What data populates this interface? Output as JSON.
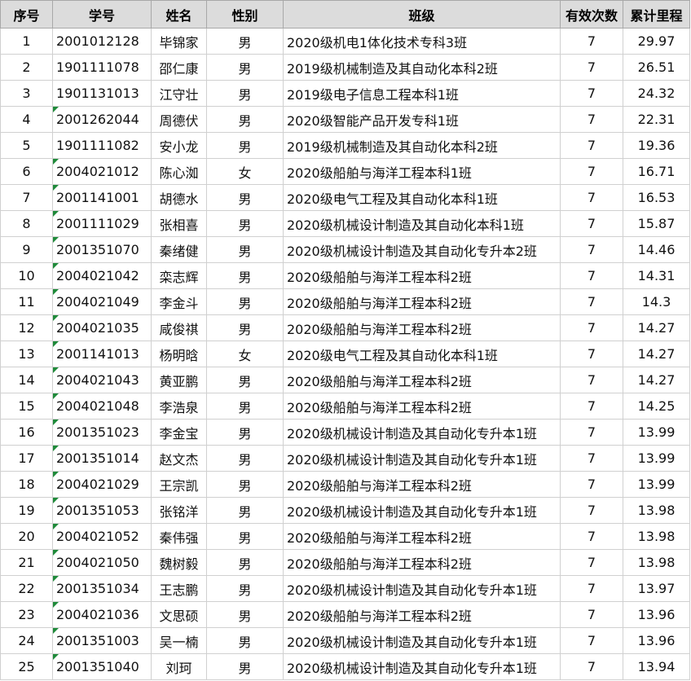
{
  "headers": [
    "序号",
    "学号",
    "姓名",
    "性别",
    "班级",
    "有效次数",
    "累计里程"
  ],
  "rows": [
    {
      "seq": "1",
      "id": "2001012128",
      "name": "毕锦家",
      "gender": "男",
      "class": "2020级机电1体化技术专科3班",
      "count": "7",
      "mileage": "29.97",
      "flag": false
    },
    {
      "seq": "2",
      "id": "1901111078",
      "name": "邵仁康",
      "gender": "男",
      "class": "2019级机械制造及其自动化本科2班",
      "count": "7",
      "mileage": "26.51",
      "flag": false
    },
    {
      "seq": "3",
      "id": "1901131013",
      "name": "江守壮",
      "gender": "男",
      "class": "2019级电子信息工程本科1班",
      "count": "7",
      "mileage": "24.32",
      "flag": false
    },
    {
      "seq": "4",
      "id": "2001262044",
      "name": "周德伏",
      "gender": "男",
      "class": "2020级智能产品开发专科1班",
      "count": "7",
      "mileage": "22.31",
      "flag": true
    },
    {
      "seq": "5",
      "id": "1901111082",
      "name": "安小龙",
      "gender": "男",
      "class": "2019级机械制造及其自动化本科2班",
      "count": "7",
      "mileage": "19.36",
      "flag": false
    },
    {
      "seq": "6",
      "id": "2004021012",
      "name": "陈心洳",
      "gender": "女",
      "class": "2020级船舶与海洋工程本科1班",
      "count": "7",
      "mileage": "16.71",
      "flag": true
    },
    {
      "seq": "7",
      "id": "2001141001",
      "name": "胡德水",
      "gender": "男",
      "class": "2020级电气工程及其自动化本科1班",
      "count": "7",
      "mileage": "16.53",
      "flag": true
    },
    {
      "seq": "8",
      "id": "2001111029",
      "name": "张相喜",
      "gender": "男",
      "class": "2020级机械设计制造及其自动化本科1班",
      "count": "7",
      "mileage": "15.87",
      "flag": true
    },
    {
      "seq": "9",
      "id": "2001351070",
      "name": "秦绪健",
      "gender": "男",
      "class": "2020级机械设计制造及其自动化专升本2班",
      "count": "7",
      "mileage": "14.46",
      "flag": true
    },
    {
      "seq": "10",
      "id": "2004021042",
      "name": "栾志辉",
      "gender": "男",
      "class": "2020级船舶与海洋工程本科2班",
      "count": "7",
      "mileage": "14.31",
      "flag": true
    },
    {
      "seq": "11",
      "id": "2004021049",
      "name": "李金斗",
      "gender": "男",
      "class": "2020级船舶与海洋工程本科2班",
      "count": "7",
      "mileage": "14.3",
      "flag": true
    },
    {
      "seq": "12",
      "id": "2004021035",
      "name": "咸俊祺",
      "gender": "男",
      "class": "2020级船舶与海洋工程本科2班",
      "count": "7",
      "mileage": "14.27",
      "flag": true
    },
    {
      "seq": "13",
      "id": "2001141013",
      "name": "杨明晗",
      "gender": "女",
      "class": "2020级电气工程及其自动化本科1班",
      "count": "7",
      "mileage": "14.27",
      "flag": true
    },
    {
      "seq": "14",
      "id": "2004021043",
      "name": "黄亚鹏",
      "gender": "男",
      "class": "2020级船舶与海洋工程本科2班",
      "count": "7",
      "mileage": "14.27",
      "flag": true
    },
    {
      "seq": "15",
      "id": "2004021048",
      "name": "李浩泉",
      "gender": "男",
      "class": "2020级船舶与海洋工程本科2班",
      "count": "7",
      "mileage": "14.25",
      "flag": true
    },
    {
      "seq": "16",
      "id": "2001351023",
      "name": "李金宝",
      "gender": "男",
      "class": "2020级机械设计制造及其自动化专升本1班",
      "count": "7",
      "mileage": "13.99",
      "flag": true
    },
    {
      "seq": "17",
      "id": "2001351014",
      "name": "赵文杰",
      "gender": "男",
      "class": "2020级机械设计制造及其自动化专升本1班",
      "count": "7",
      "mileage": "13.99",
      "flag": true
    },
    {
      "seq": "18",
      "id": "2004021029",
      "name": "王宗凯",
      "gender": "男",
      "class": "2020级船舶与海洋工程本科2班",
      "count": "7",
      "mileage": "13.99",
      "flag": true
    },
    {
      "seq": "19",
      "id": "2001351053",
      "name": "张铭洋",
      "gender": "男",
      "class": "2020级机械设计制造及其自动化专升本1班",
      "count": "7",
      "mileage": "13.98",
      "flag": true
    },
    {
      "seq": "20",
      "id": "2004021052",
      "name": "秦伟强",
      "gender": "男",
      "class": "2020级船舶与海洋工程本科2班",
      "count": "7",
      "mileage": "13.98",
      "flag": true
    },
    {
      "seq": "21",
      "id": "2004021050",
      "name": "魏树毅",
      "gender": "男",
      "class": "2020级船舶与海洋工程本科2班",
      "count": "7",
      "mileage": "13.98",
      "flag": true
    },
    {
      "seq": "22",
      "id": "2001351034",
      "name": "王志鹏",
      "gender": "男",
      "class": "2020级机械设计制造及其自动化专升本1班",
      "count": "7",
      "mileage": "13.97",
      "flag": true
    },
    {
      "seq": "23",
      "id": "2004021036",
      "name": "文思硕",
      "gender": "男",
      "class": "2020级船舶与海洋工程本科2班",
      "count": "7",
      "mileage": "13.96",
      "flag": true
    },
    {
      "seq": "24",
      "id": "2001351003",
      "name": "吴一楠",
      "gender": "男",
      "class": "2020级机械设计制造及其自动化专升本1班",
      "count": "7",
      "mileage": "13.96",
      "flag": true
    },
    {
      "seq": "25",
      "id": "2001351040",
      "name": "刘珂",
      "gender": "男",
      "class": "2020级机械设计制造及其自动化专升本1班",
      "count": "7",
      "mileage": "13.94",
      "flag": true
    }
  ]
}
